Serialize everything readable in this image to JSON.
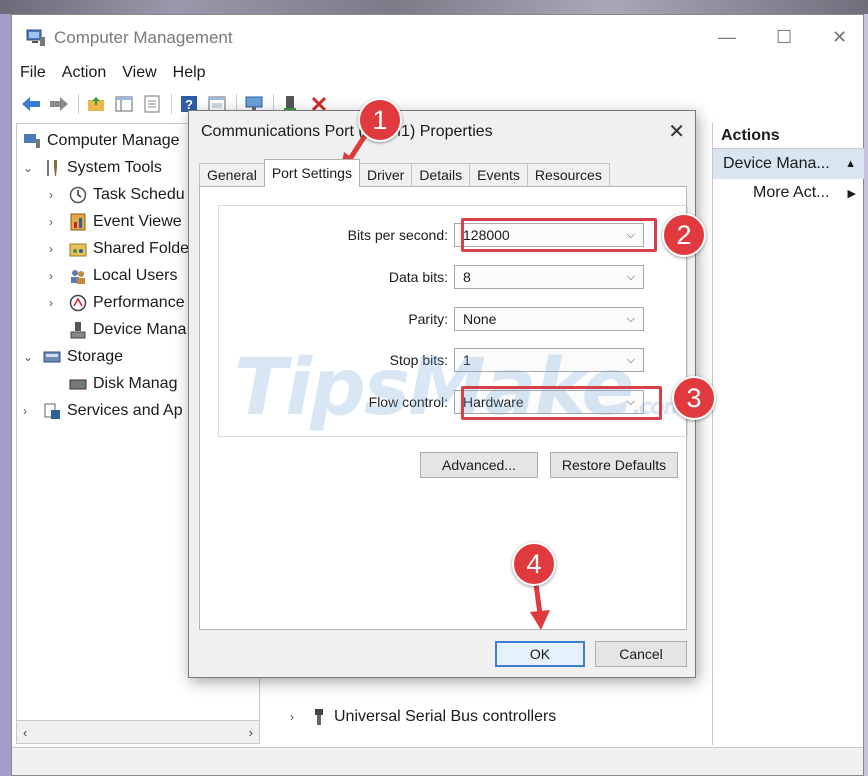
{
  "window": {
    "title": "Computer Management",
    "controls": {
      "minimize": "—",
      "maximize": "☐",
      "close": "✕"
    }
  },
  "menu": [
    "File",
    "Action",
    "View",
    "Help"
  ],
  "tree": {
    "root": "Computer Manage",
    "system_tools": "System Tools",
    "items": [
      "Task Schedu",
      "Event Viewe",
      "Shared Folde",
      "Local Users",
      "Performance",
      "Device Mana"
    ],
    "storage": "Storage",
    "disk": "Disk Manag",
    "services": "Services and Ap"
  },
  "middle": {
    "usb": "Universal Serial Bus controllers"
  },
  "actions": {
    "title": "Actions",
    "item1": "Device Mana...",
    "item2": "More Act..."
  },
  "dialog": {
    "title": "Communications Port (COM1) Properties",
    "tabs": [
      "General",
      "Port Settings",
      "Driver",
      "Details",
      "Events",
      "Resources"
    ],
    "fields": [
      {
        "label": "Bits per second:",
        "value": "128000"
      },
      {
        "label": "Data bits:",
        "value": "8"
      },
      {
        "label": "Parity:",
        "value": "None"
      },
      {
        "label": "Stop bits:",
        "value": "1"
      },
      {
        "label": "Flow control:",
        "value": "Hardware"
      }
    ],
    "advanced": "Advanced...",
    "restore": "Restore Defaults",
    "ok": "OK",
    "cancel": "Cancel"
  },
  "annotations": [
    "1",
    "2",
    "3",
    "4"
  ],
  "watermark": {
    "main": "TipsMake",
    "suffix": ".com"
  },
  "colors": {
    "accent": "#e03a3e",
    "selection": "#d9e6f2",
    "default_button": "#3c7fd4"
  }
}
